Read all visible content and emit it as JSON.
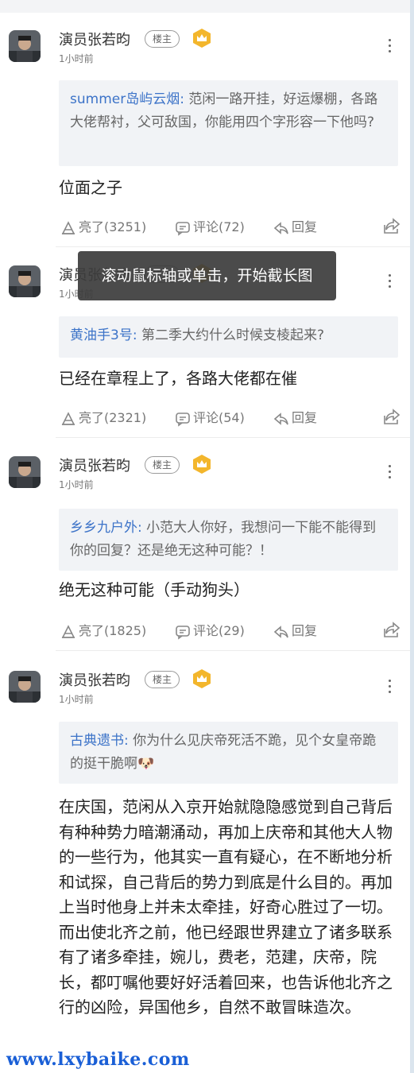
{
  "tooltip": "滚动鼠标轴或单击，开始截长图",
  "watermark": "www.lxybaike.com",
  "comments": [
    {
      "author": "演员张若昀",
      "badge": "楼主",
      "time": "1小时前",
      "quote_user": "summer岛屿云烟:",
      "quote_text": " 范闲一路开挂，好运爆棚，各路大佬帮衬，父可敌国，你能用四个字形容一下他吗?",
      "answer": "位面之子",
      "likes": "亮了(3251)",
      "comments": "评论(72)",
      "reply": "回复"
    },
    {
      "author": "演员张若昀",
      "badge": "楼主",
      "time": "1小时前",
      "quote_user": "黄油手3号:",
      "quote_text": " 第二季大约什么时候支棱起来?",
      "answer": "已经在章程上了，各路大佬都在催",
      "likes": "亮了(2321)",
      "comments": "评论(54)",
      "reply": "回复"
    },
    {
      "author": "演员张若昀",
      "badge": "楼主",
      "time": "1小时前",
      "quote_user": "乡乡九户外:",
      "quote_text": " 小范大人你好，我想问一下能不能得到你的回复？还是绝无这种可能？！",
      "answer": "绝无这种可能（手动狗头）",
      "likes": "亮了(1825)",
      "comments": "评论(29)",
      "reply": "回复"
    },
    {
      "author": "演员张若昀",
      "badge": "楼主",
      "time": "1小时前",
      "quote_user": "古典遗书:",
      "quote_text": " 你为什么见庆帝死活不跪，见个女皇帝跪的挺干脆啊🐶",
      "answer": "在庆国，范闲从入京开始就隐隐感觉到自己背后有种种势力暗潮涌动，再加上庆帝和其他大人物的一些行为，他其实一直有疑心，在不断地分析和试探，自己背后的势力到底是什么目的。再加上当时他身上并未太牵挂，好奇心胜过了一切。而出使北齐之前，他已经跟世界建立了诸多联系有了诸多牵挂，婉儿，费老，范建，庆帝，院长，都叮嘱他要好好活着回来，也告诉他北齐之行的凶险，异国他乡，自然不敢冒昧造次。",
      "likes": "",
      "comments": "",
      "reply": ""
    }
  ]
}
